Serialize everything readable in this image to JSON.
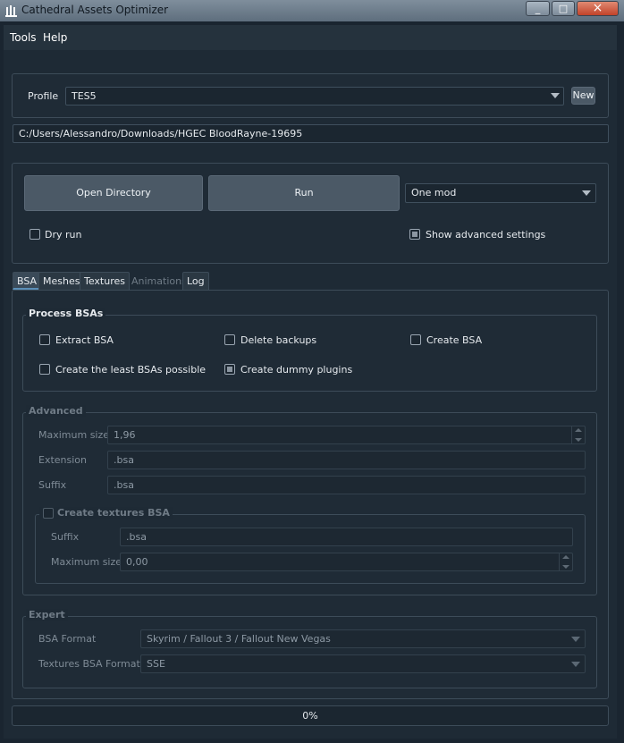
{
  "window": {
    "title": "Cathedral Assets Optimizer",
    "minimize": "_",
    "maximize": "□",
    "close": "×"
  },
  "menu": {
    "tools": "Tools",
    "help": "Help"
  },
  "profile": {
    "label": "Profile",
    "value": "TES5",
    "new_button": "New"
  },
  "path": "C:/Users/Alessandro/Downloads/HGEC BloodRayne-19695",
  "actions": {
    "open_directory": "Open Directory",
    "run": "Run",
    "mode": "One mod"
  },
  "options": {
    "dry_run": "Dry run",
    "dry_run_checked": false,
    "show_advanced": "Show advanced settings",
    "show_advanced_checked": true
  },
  "tabs": [
    {
      "label": "BSA",
      "active": true
    },
    {
      "label": "Meshes"
    },
    {
      "label": "Textures"
    },
    {
      "label": "Animations",
      "disabled": true
    },
    {
      "label": "Log"
    }
  ],
  "process_bsas": {
    "title": "Process BSAs",
    "extract": "Extract BSA",
    "extract_checked": false,
    "delete_backups": "Delete backups",
    "delete_backups_checked": false,
    "create": "Create BSA",
    "create_checked": false,
    "least": "Create the least BSAs possible",
    "least_checked": false,
    "dummy": "Create dummy plugins",
    "dummy_checked": true
  },
  "advanced": {
    "title": "Advanced",
    "max_size_label": "Maximum size",
    "max_size": "1,96",
    "extension_label": "Extension",
    "extension": ".bsa",
    "suffix_label": "Suffix",
    "suffix": ".bsa",
    "textures": {
      "title": "Create textures BSA",
      "checked": false,
      "suffix_label": "Suffix",
      "suffix": ".bsa",
      "max_size_label": "Maximum size",
      "max_size": "0,00"
    }
  },
  "expert": {
    "title": "Expert",
    "bsa_format_label": "BSA Format",
    "bsa_format": "Skyrim / Fallout 3 / Fallout New Vegas",
    "textures_format_label": "Textures BSA Format",
    "textures_format": "SSE"
  },
  "progress": {
    "text": "0%",
    "value": 0
  }
}
